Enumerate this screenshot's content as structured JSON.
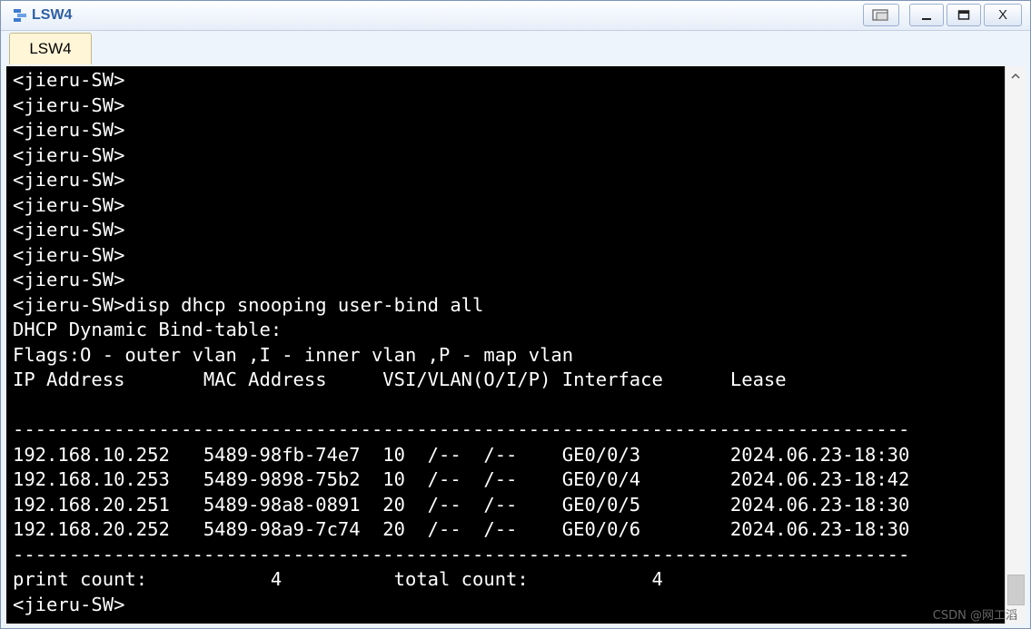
{
  "window": {
    "title": "LSW4",
    "tab_label": "LSW4",
    "buttons": {
      "restore": "restore-icon",
      "minimize": "minimize-icon",
      "maximize": "maximize-icon",
      "close_label": "X"
    }
  },
  "terminal": {
    "lines": [
      "<jieru-SW>",
      "<jieru-SW>",
      "<jieru-SW>",
      "<jieru-SW>",
      "<jieru-SW>",
      "<jieru-SW>",
      "<jieru-SW>",
      "<jieru-SW>",
      "<jieru-SW>",
      "<jieru-SW>disp dhcp snooping user-bind all",
      "DHCP Dynamic Bind-table:",
      "Flags:O - outer vlan ,I - inner vlan ,P - map vlan",
      "IP Address       MAC Address     VSI/VLAN(O/I/P) Interface      Lease",
      "",
      "--------------------------------------------------------------------------------",
      "192.168.10.252   5489-98fb-74e7  10  /--  /--    GE0/0/3        2024.06.23-18:30",
      "192.168.10.253   5489-9898-75b2  10  /--  /--    GE0/0/4        2024.06.23-18:42",
      "192.168.20.251   5489-98a8-0891  20  /--  /--    GE0/0/5        2024.06.23-18:30",
      "192.168.20.252   5489-98a9-7c74  20  /--  /--    GE0/0/6        2024.06.23-18:30",
      "--------------------------------------------------------------------------------",
      "print count:           4          total count:           4",
      "<jieru-SW>"
    ]
  },
  "watermark": "CSDN @网工滔",
  "colors": {
    "terminal_bg": "#000000",
    "terminal_fg": "#ffffff",
    "title": "#2e5fa6",
    "tab_bg": "#fff6d8"
  }
}
